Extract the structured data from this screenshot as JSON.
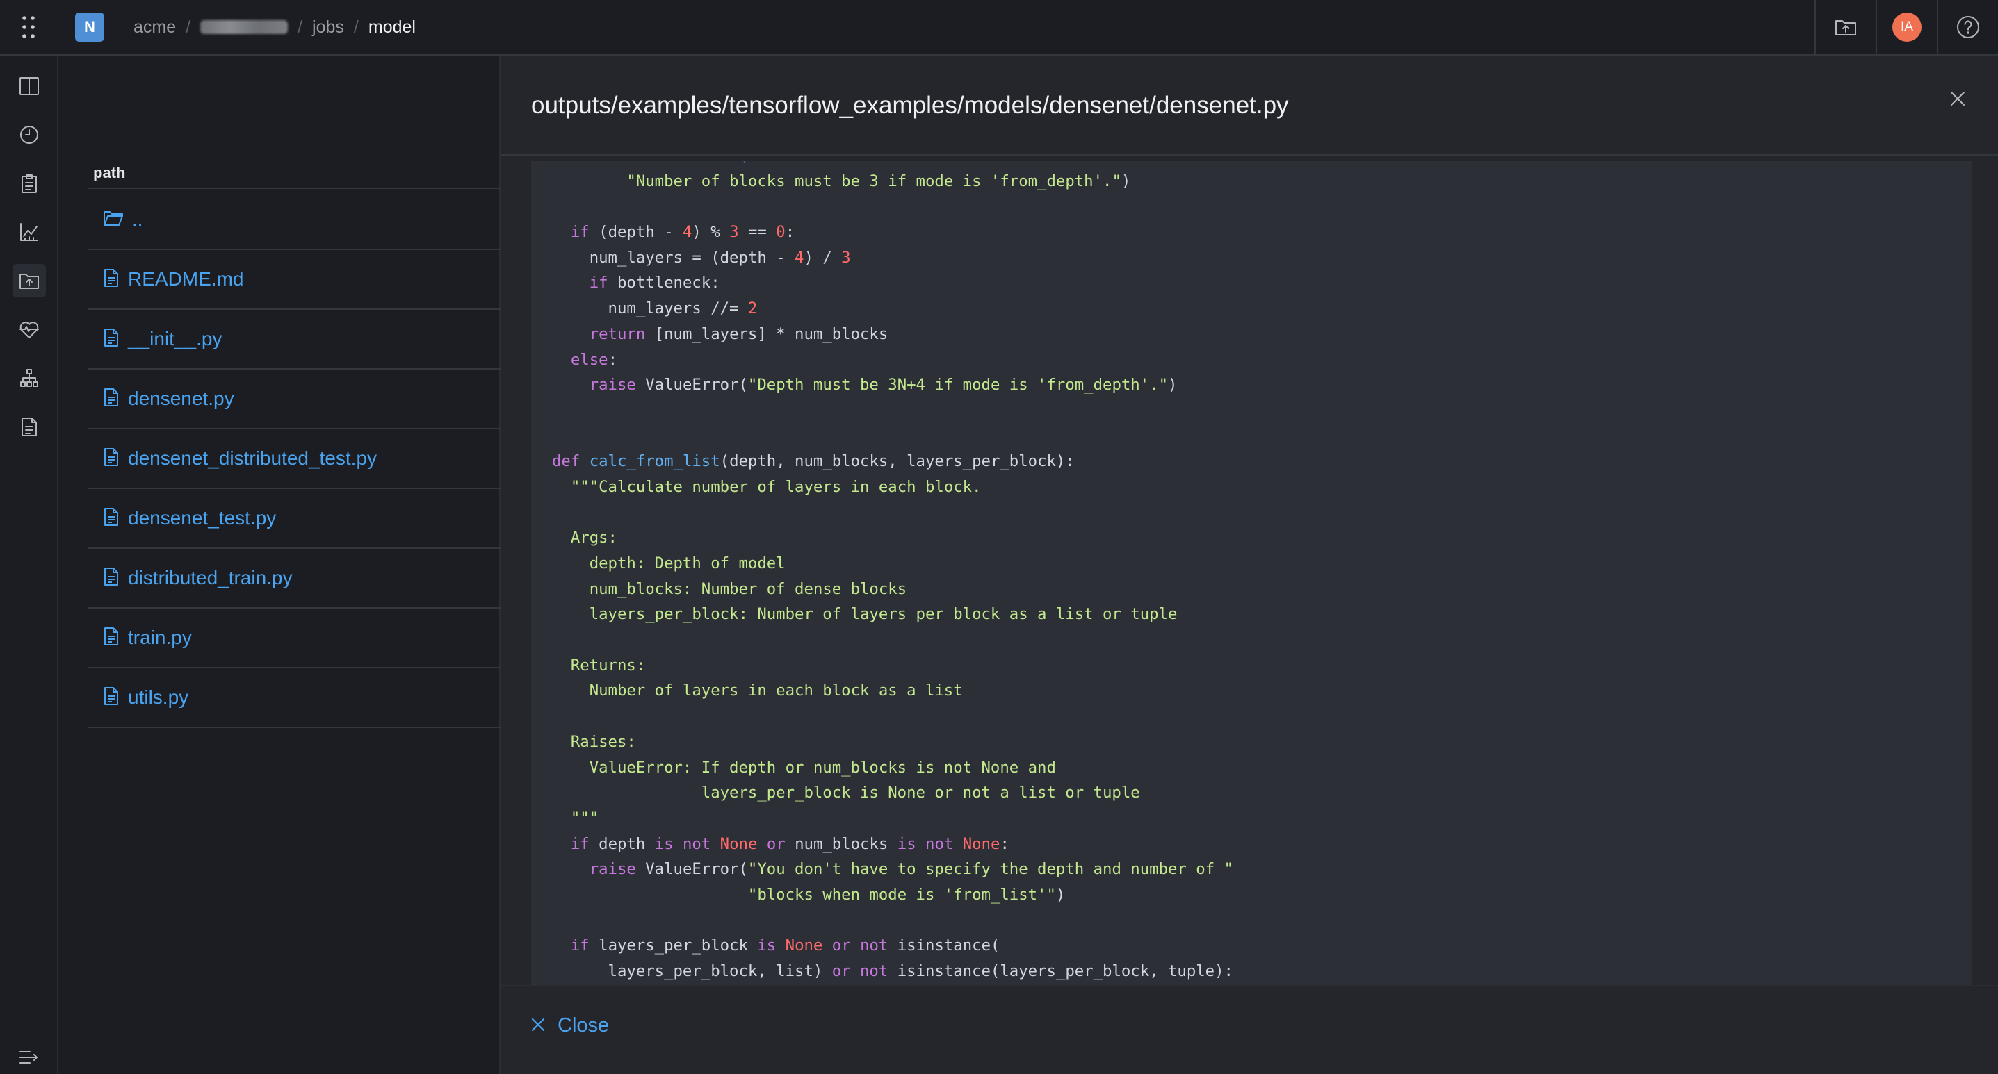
{
  "topbar": {
    "brand_letter": "N",
    "breadcrumb": [
      "acme",
      "jobs",
      "model"
    ],
    "avatar_initials": "IA"
  },
  "filepanel": {
    "column_header": "path",
    "items": [
      {
        "name": "..",
        "kind": "folder"
      },
      {
        "name": "README.md",
        "kind": "file"
      },
      {
        "name": "__init__.py",
        "kind": "file"
      },
      {
        "name": "densenet.py",
        "kind": "file"
      },
      {
        "name": "densenet_distributed_test.py",
        "kind": "file"
      },
      {
        "name": "densenet_test.py",
        "kind": "file"
      },
      {
        "name": "distributed_train.py",
        "kind": "file"
      },
      {
        "name": "train.py",
        "kind": "file"
      },
      {
        "name": "utils.py",
        "kind": "file"
      }
    ]
  },
  "viewer": {
    "title": "outputs/examples/tensorflow_examples/models/densenet/densenet.py",
    "close_label": "Close",
    "code_lines": [
      [
        [
          "faded",
          "    raise ValueError("
        ]
      ],
      [
        [
          "plain",
          "        "
        ],
        [
          "str",
          "\"Number of blocks must be 3 if mode is 'from_depth'.\""
        ],
        [
          "plain",
          ")"
        ]
      ],
      [
        [
          "plain",
          ""
        ]
      ],
      [
        [
          "plain",
          "  "
        ],
        [
          "kw",
          "if"
        ],
        [
          "plain",
          " (depth - "
        ],
        [
          "num",
          "4"
        ],
        [
          "plain",
          ") % "
        ],
        [
          "num",
          "3"
        ],
        [
          "plain",
          " == "
        ],
        [
          "num",
          "0"
        ],
        [
          "plain",
          ":"
        ]
      ],
      [
        [
          "plain",
          "    num_layers = (depth - "
        ],
        [
          "num",
          "4"
        ],
        [
          "plain",
          ") / "
        ],
        [
          "num",
          "3"
        ]
      ],
      [
        [
          "plain",
          "    "
        ],
        [
          "kw",
          "if"
        ],
        [
          "plain",
          " bottleneck:"
        ]
      ],
      [
        [
          "plain",
          "      num_layers //= "
        ],
        [
          "num",
          "2"
        ]
      ],
      [
        [
          "plain",
          "    "
        ],
        [
          "kw",
          "return"
        ],
        [
          "plain",
          " [num_layers] * num_blocks"
        ]
      ],
      [
        [
          "plain",
          "  "
        ],
        [
          "kw",
          "else"
        ],
        [
          "plain",
          ":"
        ]
      ],
      [
        [
          "plain",
          "    "
        ],
        [
          "kw",
          "raise"
        ],
        [
          "plain",
          " ValueError("
        ],
        [
          "str",
          "\"Depth must be 3N+4 if mode is 'from_depth'.\""
        ],
        [
          "plain",
          ")"
        ]
      ],
      [
        [
          "plain",
          ""
        ]
      ],
      [
        [
          "plain",
          ""
        ]
      ],
      [
        [
          "kw",
          "def"
        ],
        [
          "plain",
          " "
        ],
        [
          "fn",
          "calc_from_list"
        ],
        [
          "plain",
          "(depth, num_blocks, layers_per_block):"
        ]
      ],
      [
        [
          "plain",
          "  "
        ],
        [
          "doc",
          "\"\"\"Calculate number of layers in each block."
        ]
      ],
      [
        [
          "plain",
          ""
        ]
      ],
      [
        [
          "doc",
          "  Args:"
        ]
      ],
      [
        [
          "doc",
          "    depth: Depth of model"
        ]
      ],
      [
        [
          "doc",
          "    num_blocks: Number of dense blocks"
        ]
      ],
      [
        [
          "doc",
          "    layers_per_block: Number of layers per block as a list or tuple"
        ]
      ],
      [
        [
          "plain",
          ""
        ]
      ],
      [
        [
          "doc",
          "  Returns:"
        ]
      ],
      [
        [
          "doc",
          "    Number of layers in each block as a list"
        ]
      ],
      [
        [
          "plain",
          ""
        ]
      ],
      [
        [
          "doc",
          "  Raises:"
        ]
      ],
      [
        [
          "doc",
          "    ValueError: If depth or num_blocks is not None and"
        ]
      ],
      [
        [
          "doc",
          "                layers_per_block is None or not a list or tuple"
        ]
      ],
      [
        [
          "doc",
          "  \"\"\""
        ]
      ],
      [
        [
          "plain",
          "  "
        ],
        [
          "kw",
          "if"
        ],
        [
          "plain",
          " depth "
        ],
        [
          "kw",
          "is not"
        ],
        [
          "plain",
          " "
        ],
        [
          "const",
          "None"
        ],
        [
          "plain",
          " "
        ],
        [
          "kw",
          "or"
        ],
        [
          "plain",
          " num_blocks "
        ],
        [
          "kw",
          "is not"
        ],
        [
          "plain",
          " "
        ],
        [
          "const",
          "None"
        ],
        [
          "plain",
          ":"
        ]
      ],
      [
        [
          "plain",
          "    "
        ],
        [
          "kw",
          "raise"
        ],
        [
          "plain",
          " ValueError("
        ],
        [
          "str",
          "\"You don't have to specify the depth and number of \""
        ]
      ],
      [
        [
          "plain",
          "                     "
        ],
        [
          "str",
          "\"blocks when mode is 'from_list'\""
        ],
        [
          "plain",
          ")"
        ]
      ],
      [
        [
          "plain",
          ""
        ]
      ],
      [
        [
          "plain",
          "  "
        ],
        [
          "kw",
          "if"
        ],
        [
          "plain",
          " layers_per_block "
        ],
        [
          "kw",
          "is"
        ],
        [
          "plain",
          " "
        ],
        [
          "const",
          "None"
        ],
        [
          "plain",
          " "
        ],
        [
          "kw",
          "or not"
        ],
        [
          "plain",
          " isinstance("
        ]
      ],
      [
        [
          "plain",
          "      layers_per_block, list) "
        ],
        [
          "kw",
          "or not"
        ],
        [
          "plain",
          " isinstance(layers_per_block, tuple):"
        ]
      ]
    ]
  },
  "colors": {
    "accent": "#4aa3ee",
    "keyword": "#c678dd",
    "string": "#c3e88d",
    "number": "#ff6b6b",
    "function": "#61afef",
    "avatar": "#f07152",
    "brand": "#4f8fd6"
  }
}
